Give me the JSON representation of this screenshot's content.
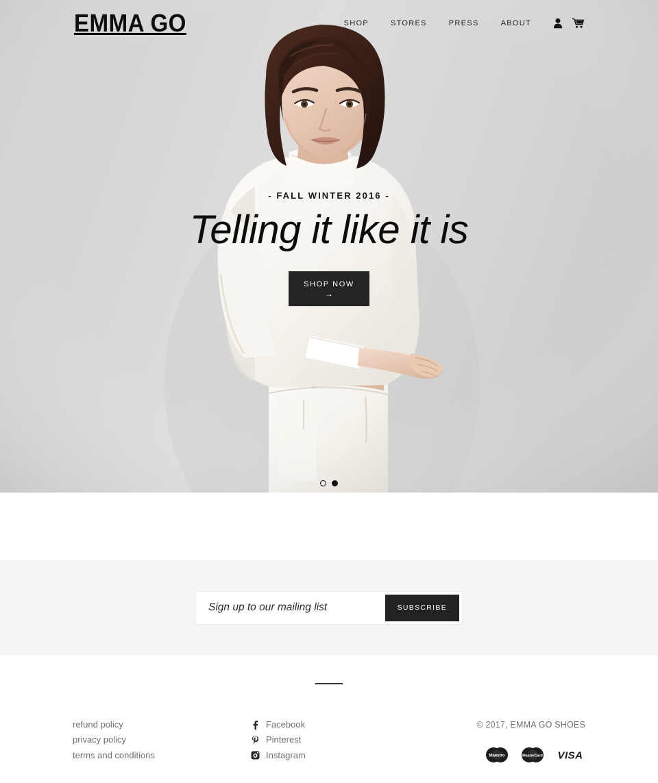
{
  "header": {
    "logo": "EMMA GO",
    "nav": [
      {
        "label": "SHOP"
      },
      {
        "label": "STORES"
      },
      {
        "label": "PRESS"
      },
      {
        "label": "ABOUT"
      }
    ],
    "icons": {
      "account": "account-icon",
      "cart": "cart-icon"
    }
  },
  "hero": {
    "eyebrow": "- FALL WINTER 2016 -",
    "title": "Telling it like it is",
    "cta_label": "SHOP NOW",
    "cta_arrow": "→",
    "slides": [
      {
        "active": false
      },
      {
        "active": true
      }
    ],
    "background_color": "#d6d6d7"
  },
  "newsletter": {
    "placeholder": "Sign up to our mailing list",
    "value": "",
    "button_label": "SUBSCRIBE",
    "background_color": "#f5f5f5"
  },
  "footer": {
    "legal_links": [
      {
        "label": "refund policy"
      },
      {
        "label": "privacy policy"
      },
      {
        "label": "terms and conditions"
      }
    ],
    "social_links": [
      {
        "label": "Facebook",
        "icon": "facebook-icon"
      },
      {
        "label": "Pinterest",
        "icon": "pinterest-icon"
      },
      {
        "label": "Instagram",
        "icon": "instagram-icon"
      }
    ],
    "copyright": "© 2017, EMMA GO SHOES",
    "payment_methods": [
      {
        "label": "Maestro"
      },
      {
        "label": "Mastercard"
      },
      {
        "label": "VISA"
      }
    ]
  }
}
